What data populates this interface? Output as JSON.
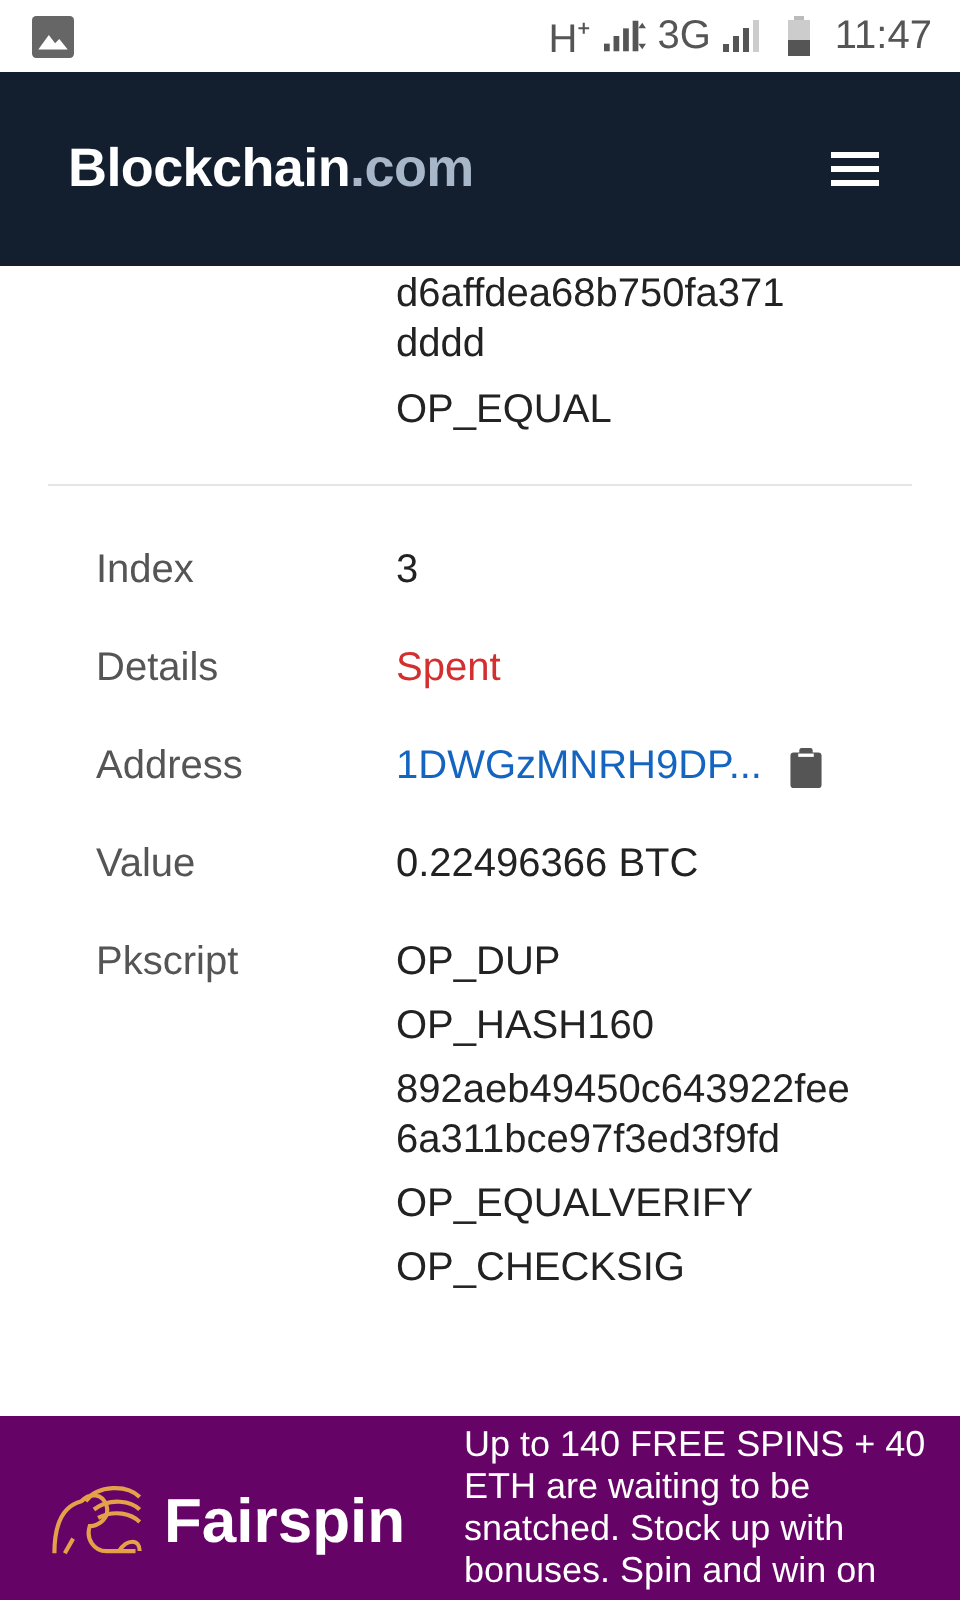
{
  "status_bar": {
    "time": "11:47",
    "network_1": "H⁺",
    "network_2": "3G"
  },
  "header": {
    "brand": "Blockchain",
    "brand_suffix": ".com"
  },
  "previous_output": {
    "pkscript_tail": [
      "d6affdea68b750fa371",
      "dddd",
      "OP_EQUAL"
    ]
  },
  "output": {
    "rows": [
      {
        "label": "Index",
        "kind": "text",
        "value": "3"
      },
      {
        "label": "Details",
        "kind": "status",
        "value": "Spent"
      },
      {
        "label": "Address",
        "kind": "address",
        "value": "1DWGzMNRH9DP..."
      },
      {
        "label": "Value",
        "kind": "text",
        "value": "0.22496366 BTC"
      },
      {
        "label": "Pkscript",
        "kind": "lines",
        "lines": [
          "OP_DUP",
          "OP_HASH160",
          "892aeb49450c643922fee6a311bce97f3ed3f9fd",
          "OP_EQUALVERIFY",
          "OP_CHECKSIG"
        ]
      }
    ]
  },
  "ad": {
    "brand": "Fairspin",
    "text": "Up to 140 FREE SPINS + 40 ETH are waiting to be snatched. Stock up with bonuses. Spin and win on"
  }
}
